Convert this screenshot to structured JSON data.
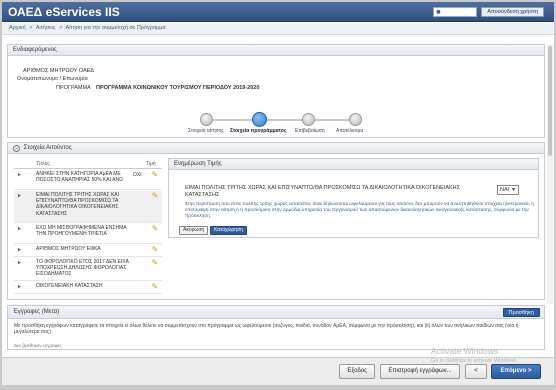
{
  "header": {
    "title": "ΟΑΕΔ eServices IIS",
    "user_name": "",
    "logout_label": "Αποσύνδεση χρήστη"
  },
  "breadcrumb": [
    "Αρχική",
    "Αιτήσεις",
    "Αίτηση για την συμμετοχή σε Πρόγραμμα"
  ],
  "stakeholder": {
    "title": "Ενδιαφερόμενος",
    "afm_label": "ΑΡΙΘΜΟΣ ΜΗΤΡΩΟΥ ΟΑΕΔ",
    "name_label": "Ονοματεπώνυμο / Επωνυμία",
    "program_label": "ΠΡΟΓΡΑΜΜΑ",
    "program_value": "ΠΡΟΓΡΑΜΜΑ ΚΟΙΝΩΝΙΚΟΥ ΤΟΥΡΙΣΜΟΥ ΠΕΡΙΟΔΟΥ 2019-2020"
  },
  "wizard": {
    "steps": [
      "Στοιχεία αίτησης",
      "Στοιχεία προγράμματος",
      "Επιβεβαίωση",
      "Αποτέλεσμα"
    ],
    "active": 1
  },
  "insured": {
    "title": "Στοιχεία Αιτούντος",
    "col_title": "Τίτλος",
    "col_value": "Τιμή",
    "rows": [
      {
        "text": "ΑΝΗΚΕΙ ΣΤΗΝ ΚΑΤΗΓΟΡΙΑ ΑμΕΑ ΜΕ ΠΟΣΟΣΤΟ ΑΝΑΠΗΡΙΑΣ 50% ΚΑΙ ΑΝΩ",
        "value": "ΟΧΙ"
      },
      {
        "text": "ΕΙΜΑΙ ΠΟΛΙΤΗΣ ΤΡΙΤΗΣ ΧΩΡΑΣ ΚΑΙ ΕΠΙΣΥΝΑΠΤΩ/ΘΑ ΠΡΟΣΚΟΜΙΣΩ ΤΑ ΔΙΚΑΙΟΛΟΓΗΤΙΚΑ ΟΙΚΟΓΕΝΕΙΑΚΗΣ ΚΑΤΑΣΤΑΣΗΣ",
        "value": ""
      },
      {
        "text": "ΕΧΩ ΜΗ ΜΙΣΘΟΓΡΑΦΗΜΕΝΑ ΕΝΣΗΜΑ ΤΗΝ ΠΡΟΗΓΟΥΜΕΝΗ ΤΡΙΕΤΙΑ",
        "value": ""
      },
      {
        "text": "ΑΡΙΘΜΟΣ ΜΗΤΡΩΟΥ ΕΦΚΑ",
        "value": ""
      },
      {
        "text": "ΤΟ ΦΟΡΟΛΟΓΙΚΟ ΕΤΟΣ 2017 ΔΕΝ ΕΙΧΑ ΥΠΟΧΡΕΩΣΗ ΔΗΛΩΣΗΣ ΦΟΡΟΛΟΓΙΑΣ ΕΙΣΟΔΗΜΑΤΟΣ",
        "value": ""
      },
      {
        "text": "ΟΙΚΟΓΕΝΕΙΑΚΗ ΚΑΤΑΣΤΑΣΗ",
        "value": ""
      }
    ]
  },
  "update_panel": {
    "title": "Ενημέρωση Τιμής",
    "question": "ΕΙΜΑΙ ΠΟΛΙΤΗΣ ΤΡΙΤΗΣ ΧΩΡΑΣ ΚΑΙ ΕΠΙΣΥΝΑΠΤΩ/ΘΑ ΠΡΟΣΚΟΜΙΣΩ ΤΑ ΔΙΚΑΙΟΛΟΓΗΤΙΚΑ ΟΙΚΟΓΕΝΕΙΑΚΗΣ ΚΑΤΑΣΤΑΣΗΣ",
    "selected": "ΝΑΙ",
    "info": "Στην περίπτωση που είστε πολίτης τρίτης χώρας απαιτείται, όταν δηλώνονται ωφελούμενοι για τους οποίους δεν μπορούν να αναζητηθηθούν στοιχεία ηλεκτρονικά, η επισύναψη στην αίτηση ή η προσκόμιση στην αρμόδια υπηρεσία του Οργανισμού των απαιτούμενων δικαιολογητικών οικογενειακής κατάστασης, σύμφωνα με την πρόσκληση.",
    "cancel_label": "Ακύρωση",
    "save_label": "Καταχώρηση"
  },
  "documents": {
    "title": "Έγγραφες (Μετα)",
    "add_label": "Προσθήκη",
    "description": "Με προσθήκη εγγράφων καταγράφετε τα στοιχεία εί όλων θέλετε να συμμετάσχουν στο πρόγραμμα ως ωφελούμενοι (σύζυγος, παιδιά, συνοδόν AμEA, σύμφωνα με την πρόσκληση), και (ii) όλων των ανήλικων παιδιών σας (νέα ή μεγαλύτερα σας)",
    "empty": "Δεν βρέθηκαν εγγραφές"
  },
  "footer": {
    "exit_label": "Έξοδος",
    "back_label": "Επιστροφή εγγράφων...",
    "prev_label": "<",
    "next_label": "Επόμενο >"
  },
  "watermark": {
    "line1": "Activate Windows",
    "line2": "Go to Settings to activate Windows."
  }
}
